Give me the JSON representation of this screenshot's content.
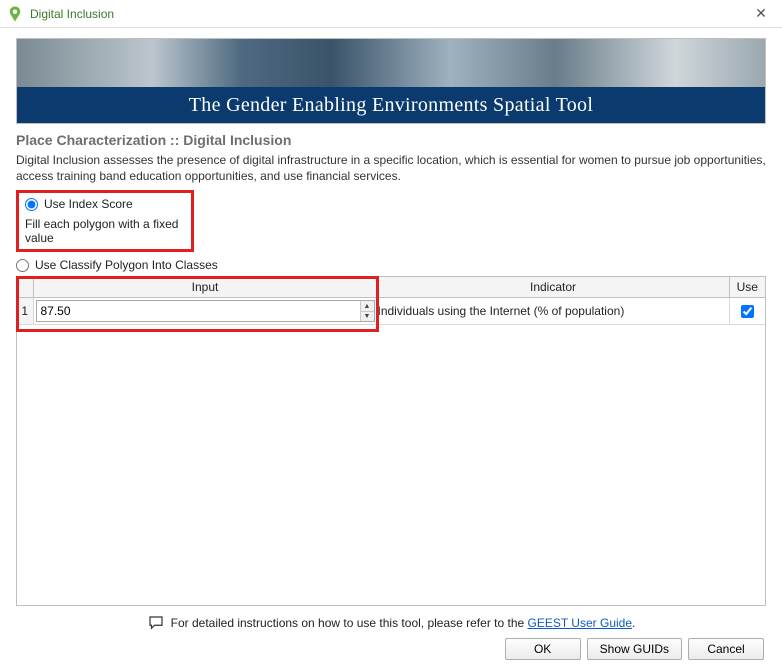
{
  "window": {
    "title": "Digital Inclusion"
  },
  "banner": {
    "title": "The Gender Enabling Environments Spatial Tool"
  },
  "section": {
    "heading": "Place Characterization :: Digital Inclusion",
    "description": "Digital Inclusion assesses the presence of digital infrastructure in a specific location, which is essential for women to pursue job opportunities, access training band education opportunities, and use financial services."
  },
  "options": {
    "use_index_score": {
      "label": "Use Index Score",
      "sublabel": "Fill each polygon with a fixed value",
      "selected": true
    },
    "classify_polygon": {
      "label": "Use Classify Polygon Into Classes",
      "selected": false
    }
  },
  "table": {
    "headers": {
      "input": "Input",
      "indicator": "Indicator",
      "use": "Use"
    },
    "rows": [
      {
        "rownum": "1",
        "input_value": "87.50",
        "indicator": "Individuals using the Internet (% of population)",
        "use_checked": true
      }
    ]
  },
  "footer": {
    "help_prefix": "For detailed instructions on how to use this tool, please refer to the ",
    "help_link_text": "GEEST User Guide",
    "help_suffix": "."
  },
  "buttons": {
    "ok": "OK",
    "show_guids": "Show GUIDs",
    "cancel": "Cancel"
  }
}
